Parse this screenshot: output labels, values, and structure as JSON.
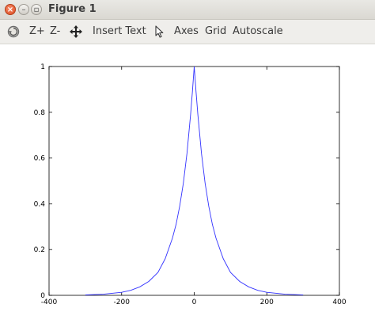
{
  "window": {
    "title": "Figure 1"
  },
  "toolbar": {
    "rotate_icon": "rotate-icon",
    "zoom_in_label": "Z+",
    "zoom_out_label": "Z-",
    "pan_icon": "pan-arrows-icon",
    "insert_text_label": "Insert Text",
    "select_icon": "pointer-icon",
    "axes_label": "Axes",
    "grid_label": "Grid",
    "autoscale_label": "Autoscale"
  },
  "colors": {
    "line": "#3333ff",
    "axes": "#000000",
    "close_button": "#e4572b"
  },
  "chart_data": {
    "type": "line",
    "title": "",
    "xlabel": "",
    "ylabel": "",
    "xlim": [
      -400,
      400
    ],
    "ylim": [
      0,
      1
    ],
    "grid": false,
    "xticks": [
      -400,
      -200,
      0,
      200,
      400
    ],
    "yticks": [
      0,
      0.2,
      0.4,
      0.6,
      0.8,
      1
    ],
    "xtick_labels": [
      "-400",
      "-200",
      "0",
      "200",
      "400"
    ],
    "ytick_labels": [
      "0",
      "0.2",
      "0.4",
      "0.6",
      "0.8",
      "1"
    ],
    "series": [
      {
        "x": [
          -300,
          -250,
          -200,
          -175,
          -150,
          -125,
          -100,
          -80,
          -60,
          -50,
          -40,
          -30,
          -20,
          -10,
          -5,
          0,
          5,
          10,
          20,
          30,
          40,
          50,
          60,
          80,
          100,
          125,
          150,
          175,
          200,
          250,
          300
        ],
        "y": [
          0.0017,
          0.0048,
          0.013,
          0.022,
          0.037,
          0.061,
          0.1,
          0.16,
          0.25,
          0.31,
          0.39,
          0.49,
          0.62,
          0.79,
          0.89,
          1.0,
          0.89,
          0.79,
          0.62,
          0.49,
          0.39,
          0.31,
          0.25,
          0.16,
          0.1,
          0.061,
          0.037,
          0.022,
          0.013,
          0.0048,
          0.0017
        ]
      }
    ]
  }
}
